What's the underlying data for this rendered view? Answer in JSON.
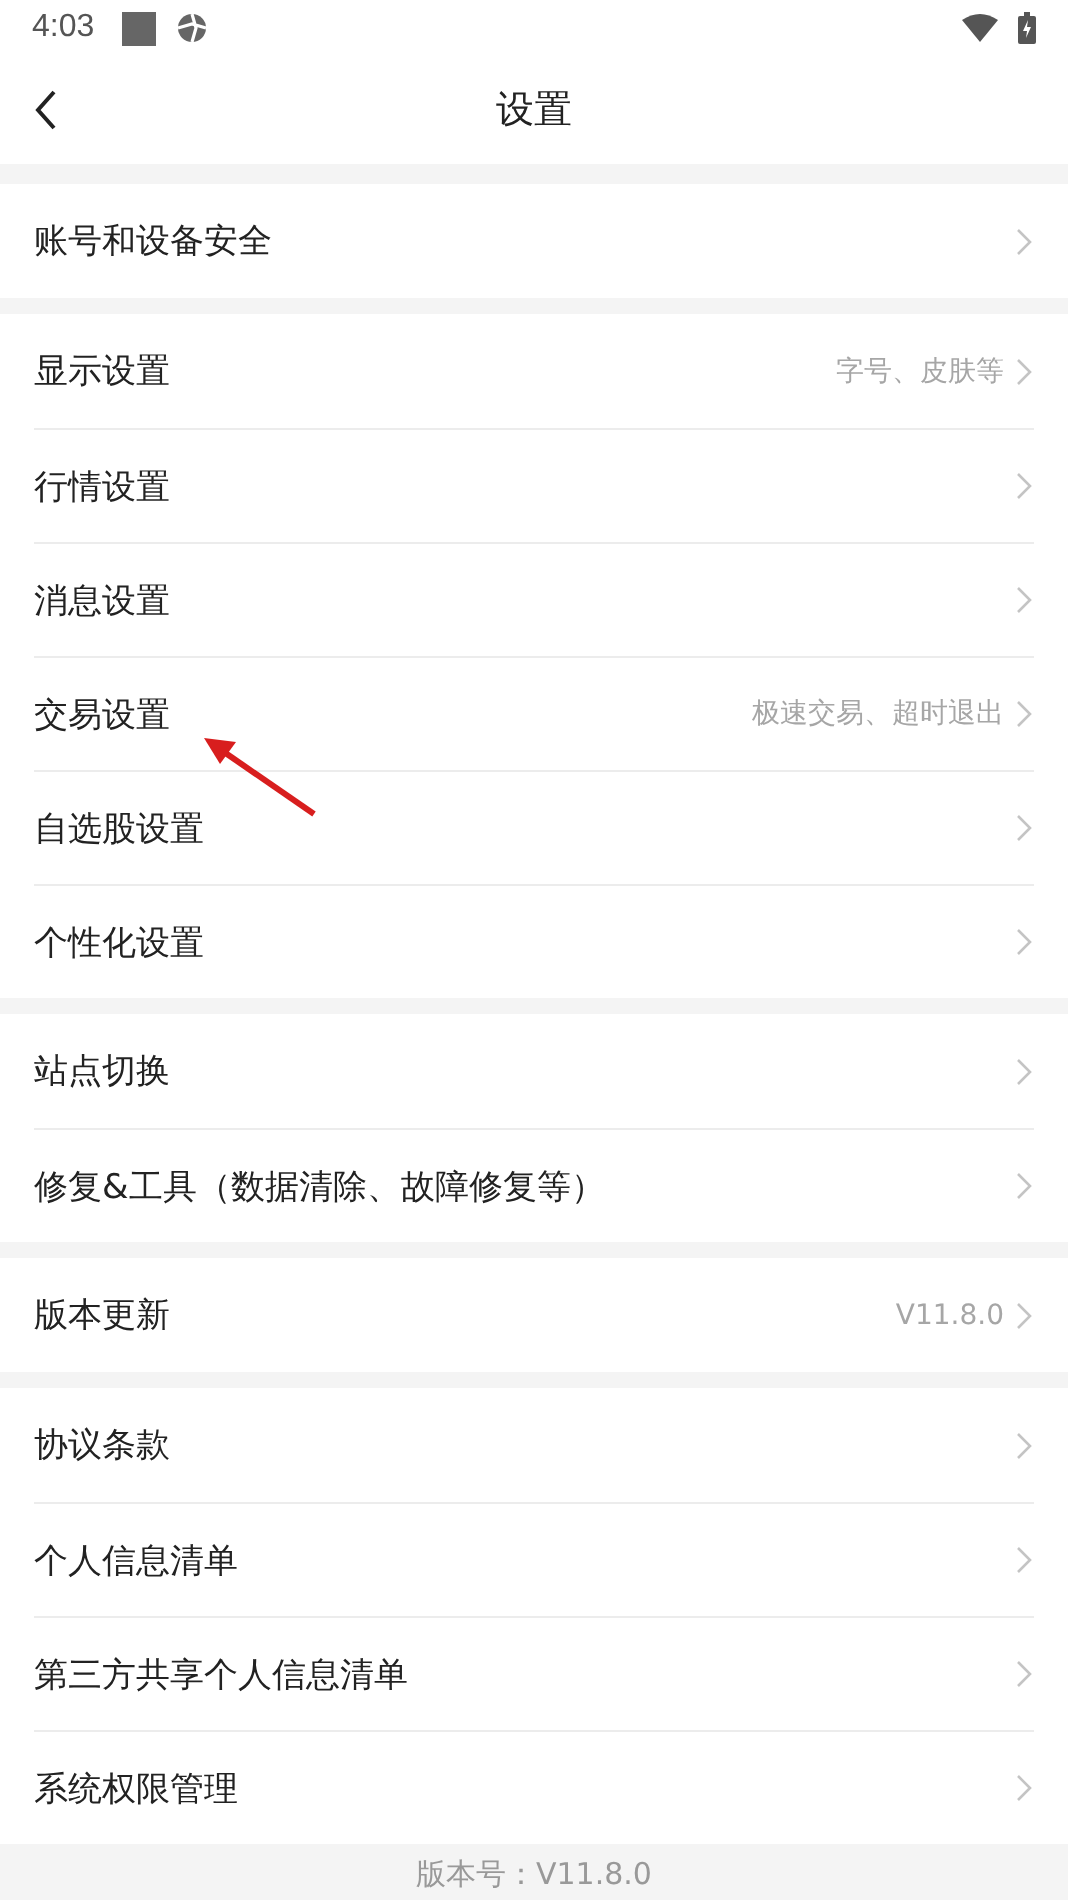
{
  "status_bar": {
    "time": "4:03"
  },
  "header": {
    "title": "设置"
  },
  "sections": [
    {
      "items": [
        {
          "label": "账号和设备安全"
        }
      ]
    },
    {
      "items": [
        {
          "label": "显示设置",
          "hint": "字号、皮肤等"
        },
        {
          "label": "行情设置"
        },
        {
          "label": "消息设置"
        },
        {
          "label": "交易设置",
          "hint": "极速交易、超时退出"
        },
        {
          "label": "自选股设置"
        },
        {
          "label": "个性化设置"
        }
      ]
    },
    {
      "items": [
        {
          "label": "站点切换"
        },
        {
          "label": "修复&工具（数据清除、故障修复等）"
        }
      ]
    },
    {
      "items": [
        {
          "label": "版本更新",
          "hint": "V11.8.0"
        }
      ]
    },
    {
      "items": [
        {
          "label": "协议条款"
        },
        {
          "label": "个人信息清单"
        },
        {
          "label": "第三方共享个人信息清单"
        },
        {
          "label": "系统权限管理"
        }
      ]
    }
  ],
  "footer": {
    "version": "版本号：V11.8.0"
  }
}
